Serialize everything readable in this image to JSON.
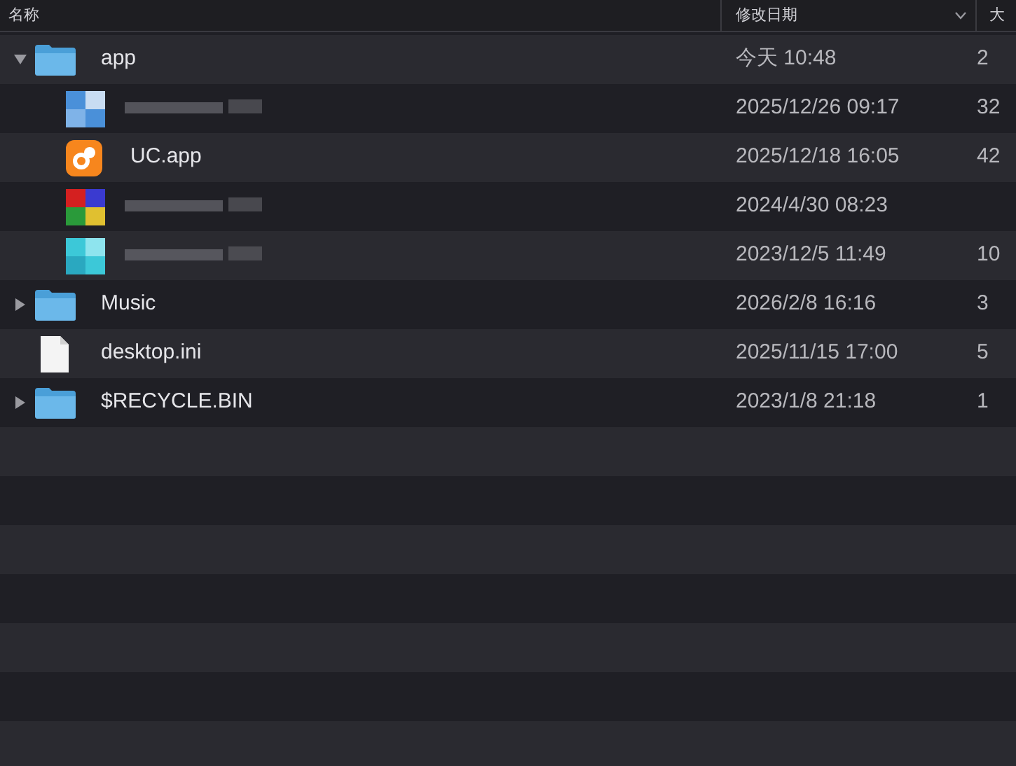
{
  "columns": [
    {
      "label": "名称"
    },
    {
      "label": "修改日期",
      "sort_caret": true
    },
    {
      "label": "大"
    }
  ],
  "items": [
    {
      "kind": "folder",
      "name": "app",
      "date": "今天 10:48",
      "size": "2",
      "expanded": true,
      "children": [
        {
          "kind": "picture",
          "date": "2025/12/26 09:17",
          "size": "32"
        },
        {
          "kind": "app",
          "name": "UC.app",
          "date": "2025/12/18 16:05",
          "size": "42"
        },
        {
          "kind": "picture",
          "date": "2024/4/30 08:23"
        },
        {
          "kind": "picture",
          "date": "2023/12/5 11:49",
          "size": "10"
        }
      ]
    },
    {
      "kind": "folder",
      "name": "Music",
      "date": "2026/2/8 16:16",
      "size": "3",
      "expanded": false
    },
    {
      "kind": "file",
      "name": "desktop.ini",
      "date": "2025/11/15 17:00",
      "size": "5"
    },
    {
      "kind": "folder",
      "name": "$RECYCLE.BIN",
      "date": "2023/1/8 21:18",
      "size": "1",
      "expanded": false
    }
  ]
}
